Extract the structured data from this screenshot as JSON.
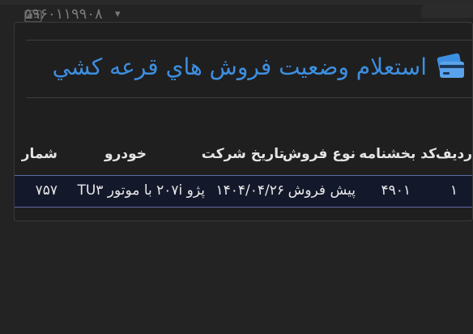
{
  "top_bar": {
    "dropdown_value": "۵۹۶۰۱۱۹۹۰۸",
    "dropdown_icon": "id-card-icon",
    "chevron": "▾"
  },
  "card": {
    "title": "استعلام وضعيت فروش هاي قرعه کشي",
    "title_icon": "credit-card-icon",
    "accent_color": "#3d8fe0"
  },
  "table": {
    "headers": {
      "row": "رديف",
      "code": "کد بخشنامه",
      "sale_type": "نوع فروش",
      "date": "تاريخ شرکت",
      "car": "خودرو",
      "number": "شمار"
    },
    "rows": [
      {
        "row": "۱",
        "code": "۴۹۰۱",
        "sale_type": "پيش فروش",
        "date": "۱۴۰۴/۰۴/۲۶",
        "car": "پژو ۲۰۷i با موتور TU۳",
        "number": "۷۵۷"
      }
    ],
    "row_highlight_color": "#14182b",
    "row_border_color": "#5d6aa8"
  }
}
